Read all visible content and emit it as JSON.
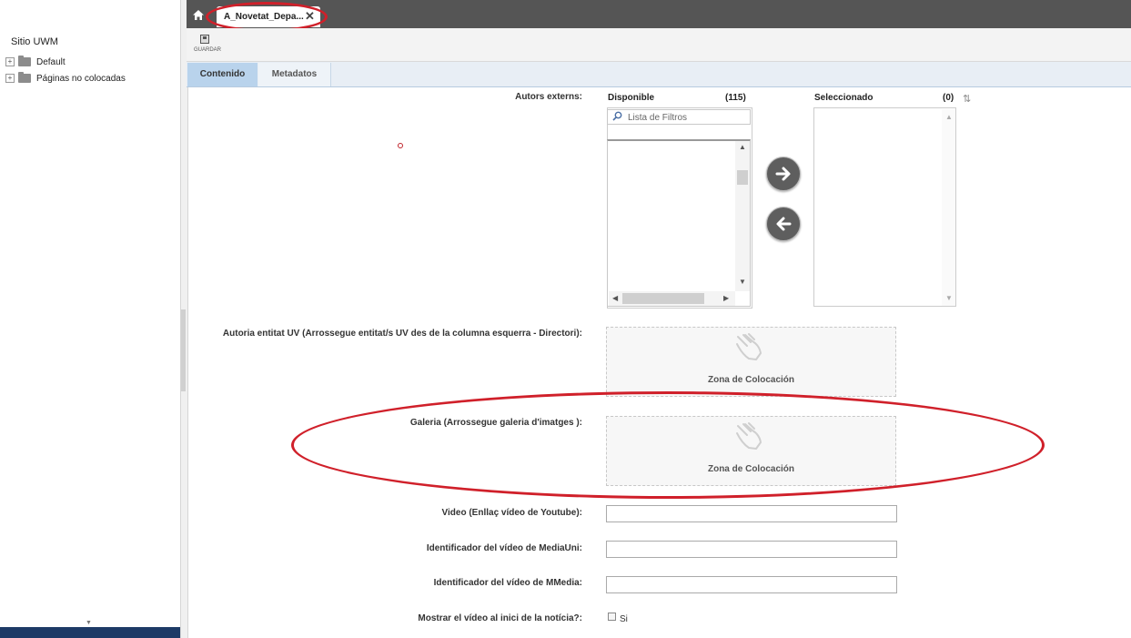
{
  "sidebar": {
    "site_title": "Sitio UWM",
    "items": [
      {
        "label": "Default",
        "toggle": "+"
      },
      {
        "label": "Páginas no colocadas",
        "toggle": "+"
      }
    ]
  },
  "tabs": {
    "home_icon": "home-icon",
    "document_tab": {
      "label": "A_Novetat_Depa...",
      "close": "✕"
    }
  },
  "toolbar": {
    "save_label": "GUARDAR"
  },
  "form_tabs": [
    "Contenido",
    "Metadatos"
  ],
  "fields": {
    "autors_externs": {
      "label": "Autors externs:",
      "available_title": "Disponible",
      "available_count": "(115)",
      "filter_placeholder": "Lista de Filtros",
      "selected_title": "Seleccionado",
      "selected_count": "(0)"
    },
    "autoria": {
      "label": "Autoria entitat UV (Arrossegue entitat/s UV des de la columna esquerra - Directori):",
      "drop_label": "Zona de Colocación"
    },
    "galeria": {
      "label": "Galeria (Arrossegue galeria d'imatges ):",
      "drop_label": "Zona de Colocación"
    },
    "video_youtube": {
      "label": "Video (Enllaç vídeo de Youtube):",
      "value": ""
    },
    "mediauni": {
      "label": "Identificador del vídeo de MediaUni:",
      "value": ""
    },
    "mmedia": {
      "label": "Identificador del vídeo de MMedia:",
      "value": ""
    },
    "show_video": {
      "label": "Mostrar el vídeo al inici de la notícia?:",
      "option": "Si",
      "checked": false
    }
  },
  "colors": {
    "annotation_red": "#d0202a",
    "tab_bar": "#555555",
    "active_form_tab": "#b9d3ec"
  }
}
